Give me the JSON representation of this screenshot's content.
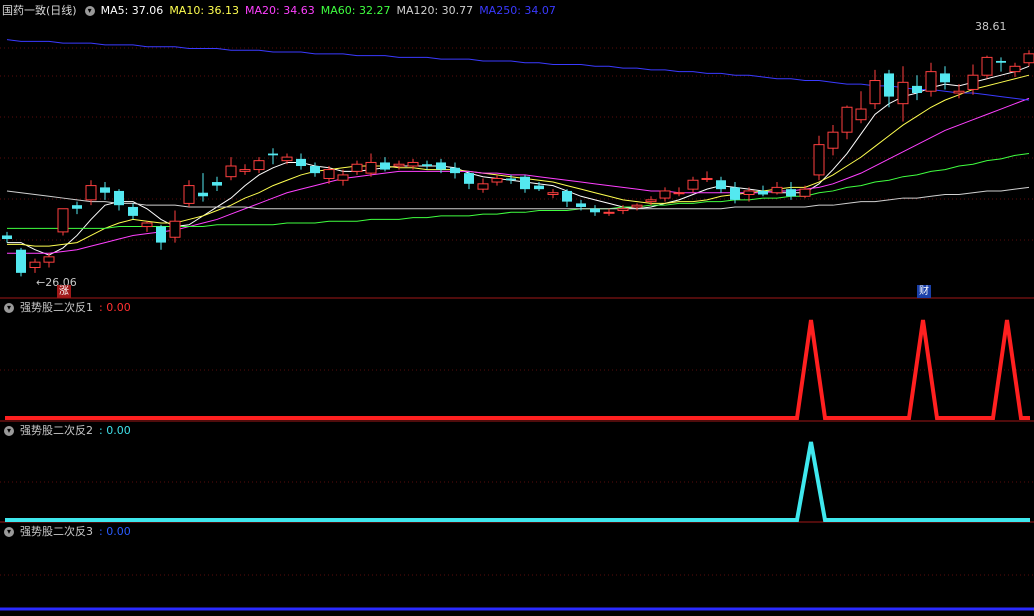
{
  "header": {
    "stock_title": "国药一致(日线)",
    "ma": [
      {
        "label": "MA5: 37.06",
        "color": "#ffffff"
      },
      {
        "label": "MA10: 36.13",
        "color": "#ffff50"
      },
      {
        "label": "MA20: 34.63",
        "color": "#ff40ff"
      },
      {
        "label": "MA60: 32.27",
        "color": "#40ff40"
      },
      {
        "label": "MA120: 30.77",
        "color": "#d0d0d0"
      },
      {
        "label": "MA250: 34.07",
        "color": "#3a3aff"
      }
    ]
  },
  "price_marks": {
    "high": "38.61",
    "low": "26.06"
  },
  "badges": {
    "zhang": "涨",
    "cai": "财"
  },
  "indicators": [
    {
      "title": "强势股二次反1",
      "value": ": 0.00",
      "color": "#ff2020"
    },
    {
      "title": "强势股二次反2",
      "value": ": 0.00",
      "color": "#3fe8ee"
    },
    {
      "title": "强势股二次反3",
      "value": ": 0.00",
      "color": "#2a5cff"
    }
  ],
  "chart_data": {
    "type": "candlestick",
    "y_range": [
      25.0,
      40.5
    ],
    "candles": [
      [
        28.4,
        28.2,
        28.6,
        28.0
      ],
      [
        27.6,
        26.3,
        27.7,
        26.1
      ],
      [
        26.6,
        26.9,
        27.1,
        26.3
      ],
      [
        26.9,
        27.2,
        27.4,
        26.6
      ],
      [
        28.6,
        29.9,
        29.9,
        28.4
      ],
      [
        30.1,
        29.9,
        30.3,
        29.6
      ],
      [
        30.4,
        31.2,
        31.5,
        30.1
      ],
      [
        31.1,
        30.8,
        31.4,
        30.4
      ],
      [
        30.9,
        30.1,
        31.0,
        29.8
      ],
      [
        30.0,
        29.5,
        30.2,
        29.3
      ],
      [
        28.9,
        29.1,
        29.2,
        28.6
      ],
      [
        28.9,
        28.0,
        29.0,
        27.6
      ],
      [
        28.3,
        29.2,
        29.8,
        28.0
      ],
      [
        30.2,
        31.2,
        31.5,
        30.0
      ],
      [
        30.8,
        30.6,
        31.9,
        30.3
      ],
      [
        31.4,
        31.2,
        31.7,
        30.9
      ],
      [
        31.7,
        32.3,
        32.8,
        31.5
      ],
      [
        32.0,
        32.1,
        32.4,
        31.8
      ],
      [
        32.1,
        32.6,
        32.8,
        31.9
      ],
      [
        33.0,
        32.9,
        33.3,
        32.4
      ],
      [
        32.6,
        32.8,
        33.0,
        32.4
      ],
      [
        32.7,
        32.3,
        33.0,
        32.1
      ],
      [
        32.3,
        31.9,
        32.5,
        31.7
      ],
      [
        31.6,
        32.1,
        32.3,
        31.3
      ],
      [
        31.5,
        31.8,
        32.1,
        31.2
      ],
      [
        32.0,
        32.4,
        32.6,
        31.8
      ],
      [
        31.9,
        32.5,
        33.0,
        31.7
      ],
      [
        32.5,
        32.1,
        32.8,
        32.0
      ],
      [
        32.3,
        32.4,
        32.6,
        32.1
      ],
      [
        32.3,
        32.5,
        32.7,
        32.1
      ],
      [
        32.4,
        32.3,
        32.6,
        32.1
      ],
      [
        32.5,
        32.1,
        32.7,
        31.9
      ],
      [
        32.2,
        31.9,
        32.5,
        31.6
      ],
      [
        31.9,
        31.3,
        32.0,
        31.0
      ],
      [
        31.0,
        31.3,
        31.6,
        30.8
      ],
      [
        31.4,
        31.6,
        31.8,
        31.2
      ],
      [
        31.6,
        31.5,
        31.8,
        31.3
      ],
      [
        31.7,
        31.0,
        31.8,
        30.8
      ],
      [
        31.2,
        31.0,
        31.4,
        30.9
      ],
      [
        30.7,
        30.8,
        31.0,
        30.5
      ],
      [
        30.9,
        30.3,
        31.0,
        30.0
      ],
      [
        30.2,
        30.0,
        30.4,
        29.8
      ],
      [
        29.9,
        29.7,
        30.1,
        29.5
      ],
      [
        29.7,
        29.7,
        29.9,
        29.5
      ],
      [
        29.8,
        29.9,
        30.1,
        29.6
      ],
      [
        30.0,
        30.1,
        30.2,
        29.8
      ],
      [
        30.3,
        30.4,
        30.6,
        30.1
      ],
      [
        30.5,
        30.9,
        31.1,
        30.3
      ],
      [
        30.8,
        30.8,
        31.1,
        30.6
      ],
      [
        31.0,
        31.5,
        31.7,
        30.8
      ],
      [
        31.6,
        31.6,
        32.0,
        31.4
      ],
      [
        31.5,
        31.0,
        31.7,
        30.8
      ],
      [
        31.1,
        30.4,
        31.4,
        30.2
      ],
      [
        30.7,
        30.9,
        31.1,
        30.3
      ],
      [
        30.9,
        30.7,
        31.2,
        30.6
      ],
      [
        30.8,
        31.1,
        31.4,
        30.7
      ],
      [
        31.0,
        30.6,
        31.4,
        30.4
      ],
      [
        30.6,
        31.0,
        31.2,
        30.5
      ],
      [
        31.8,
        33.5,
        34.0,
        31.5
      ],
      [
        33.3,
        34.2,
        34.6,
        32.9
      ],
      [
        34.2,
        35.6,
        35.7,
        33.8
      ],
      [
        34.9,
        35.5,
        36.5,
        34.7
      ],
      [
        35.8,
        37.1,
        37.7,
        35.5
      ],
      [
        37.5,
        36.2,
        37.7,
        35.6
      ],
      [
        35.8,
        37.0,
        37.9,
        34.8
      ],
      [
        36.8,
        36.4,
        37.4,
        36.0
      ],
      [
        36.5,
        37.6,
        38.1,
        36.2
      ],
      [
        37.5,
        37.0,
        37.9,
        36.6
      ],
      [
        36.4,
        36.5,
        36.9,
        36.1
      ],
      [
        36.6,
        37.4,
        38.0,
        36.3
      ],
      [
        37.4,
        38.4,
        38.5,
        37.2
      ],
      [
        38.2,
        38.1,
        38.4,
        37.6
      ],
      [
        37.6,
        37.9,
        38.1,
        37.3
      ],
      [
        38.1,
        38.6,
        38.8,
        37.9
      ]
    ],
    "ma_lines": [
      {
        "name": "MA5",
        "color": "#ffffff",
        "values": [
          28.0,
          28.0,
          27.6,
          27.3,
          27.7,
          28.4,
          29.3,
          30.1,
          30.3,
          30.3,
          29.9,
          29.3,
          28.9,
          29.0,
          29.5,
          30.0,
          30.5,
          31.2,
          31.8,
          32.2,
          32.5,
          32.5,
          32.3,
          32.2,
          32.0,
          32.0,
          32.1,
          32.2,
          32.3,
          32.3,
          32.3,
          32.3,
          32.2,
          31.9,
          31.7,
          31.6,
          31.5,
          31.4,
          31.3,
          31.2,
          30.9,
          30.6,
          30.4,
          30.2,
          30.0,
          29.9,
          30.0,
          30.2,
          30.4,
          30.7,
          31.0,
          31.2,
          31.1,
          31.0,
          30.9,
          30.8,
          30.8,
          30.8,
          31.3,
          32.1,
          33.0,
          34.1,
          35.2,
          35.8,
          36.2,
          36.4,
          36.7,
          36.9,
          36.8,
          37.0,
          37.2,
          37.4,
          37.6,
          37.9
        ]
      },
      {
        "name": "MA10",
        "color": "#ffff50",
        "values": [
          27.9,
          27.9,
          27.8,
          27.8,
          27.9,
          28.0,
          28.4,
          28.8,
          29.1,
          29.3,
          29.2,
          29.1,
          29.1,
          29.3,
          29.5,
          29.8,
          30.1,
          30.5,
          30.8,
          31.2,
          31.5,
          31.8,
          32.0,
          32.1,
          32.2,
          32.3,
          32.3,
          32.3,
          32.2,
          32.2,
          32.1,
          32.1,
          32.1,
          32.0,
          31.9,
          31.8,
          31.7,
          31.6,
          31.5,
          31.4,
          31.2,
          31.0,
          30.8,
          30.6,
          30.4,
          30.3,
          30.2,
          30.2,
          30.3,
          30.3,
          30.4,
          30.6,
          30.7,
          30.8,
          30.9,
          31.0,
          31.1,
          31.1,
          31.4,
          31.8,
          32.3,
          32.8,
          33.4,
          34.0,
          34.6,
          35.1,
          35.6,
          36.0,
          36.3,
          36.6,
          36.8,
          37.0,
          37.2,
          37.4
        ]
      },
      {
        "name": "MA20",
        "color": "#ff40ff",
        "values": [
          27.4,
          27.4,
          27.4,
          27.4,
          27.5,
          27.6,
          27.8,
          28.0,
          28.2,
          28.4,
          28.5,
          28.6,
          28.7,
          28.9,
          29.1,
          29.3,
          29.6,
          29.9,
          30.2,
          30.5,
          30.8,
          31.0,
          31.2,
          31.4,
          31.6,
          31.7,
          31.8,
          31.9,
          32.0,
          32.0,
          32.0,
          32.0,
          32.0,
          32.0,
          31.9,
          31.9,
          31.8,
          31.8,
          31.7,
          31.6,
          31.5,
          31.4,
          31.3,
          31.2,
          31.1,
          31.0,
          30.9,
          30.9,
          30.8,
          30.8,
          30.8,
          30.8,
          30.8,
          30.8,
          30.8,
          30.9,
          30.9,
          31.0,
          31.1,
          31.3,
          31.6,
          31.9,
          32.3,
          32.7,
          33.1,
          33.5,
          33.9,
          34.3,
          34.6,
          34.9,
          35.2,
          35.5,
          35.8,
          36.1
        ]
      },
      {
        "name": "MA60",
        "color": "#40ff40",
        "values": [
          28.8,
          28.8,
          28.8,
          28.8,
          28.8,
          28.8,
          28.8,
          28.8,
          28.9,
          28.9,
          28.9,
          28.9,
          28.9,
          28.9,
          28.9,
          29.0,
          29.0,
          29.0,
          29.0,
          29.0,
          29.1,
          29.1,
          29.1,
          29.2,
          29.2,
          29.2,
          29.3,
          29.3,
          29.3,
          29.4,
          29.4,
          29.5,
          29.5,
          29.5,
          29.6,
          29.6,
          29.7,
          29.7,
          29.8,
          29.8,
          29.8,
          29.9,
          29.9,
          29.9,
          30.0,
          30.0,
          30.1,
          30.1,
          30.2,
          30.2,
          30.3,
          30.3,
          30.4,
          30.4,
          30.5,
          30.5,
          30.6,
          30.6,
          30.8,
          30.9,
          31.1,
          31.2,
          31.4,
          31.5,
          31.7,
          31.8,
          32.0,
          32.1,
          32.3,
          32.4,
          32.6,
          32.7,
          32.9,
          33.0
        ]
      },
      {
        "name": "MA120",
        "color": "#d0d0d0",
        "values": [
          30.9,
          30.8,
          30.7,
          30.6,
          30.5,
          30.4,
          30.3,
          30.3,
          30.2,
          30.2,
          30.1,
          30.1,
          30.1,
          30.0,
          30.0,
          30.0,
          30.0,
          30.0,
          29.9,
          29.9,
          29.9,
          29.9,
          29.9,
          29.9,
          29.9,
          29.9,
          29.9,
          29.9,
          29.9,
          29.9,
          29.9,
          29.9,
          29.9,
          29.9,
          29.9,
          29.9,
          29.9,
          29.9,
          29.9,
          29.9,
          29.9,
          29.9,
          29.9,
          29.9,
          29.9,
          29.9,
          29.9,
          29.9,
          29.9,
          29.9,
          29.9,
          29.9,
          30.0,
          30.0,
          30.0,
          30.0,
          30.0,
          30.0,
          30.1,
          30.1,
          30.2,
          30.3,
          30.3,
          30.4,
          30.5,
          30.5,
          30.6,
          30.7,
          30.7,
          30.8,
          30.9,
          30.9,
          31.0,
          31.1
        ]
      },
      {
        "name": "MA250",
        "color": "#3a3aff",
        "values": [
          39.4,
          39.3,
          39.3,
          39.3,
          39.2,
          39.2,
          39.2,
          39.1,
          39.1,
          39.1,
          39.0,
          39.0,
          39.0,
          38.9,
          38.9,
          38.9,
          38.8,
          38.8,
          38.8,
          38.7,
          38.7,
          38.7,
          38.6,
          38.6,
          38.6,
          38.5,
          38.5,
          38.5,
          38.4,
          38.4,
          38.4,
          38.3,
          38.3,
          38.3,
          38.2,
          38.2,
          38.2,
          38.1,
          38.1,
          38.0,
          38.0,
          38.0,
          37.9,
          37.9,
          37.8,
          37.8,
          37.7,
          37.7,
          37.6,
          37.6,
          37.5,
          37.5,
          37.4,
          37.4,
          37.3,
          37.2,
          37.2,
          37.1,
          37.1,
          37.0,
          36.9,
          36.9,
          36.8,
          36.8,
          36.7,
          36.6,
          36.6,
          36.5,
          36.4,
          36.4,
          36.3,
          36.2,
          36.1,
          36.0
        ]
      }
    ],
    "signal1": {
      "color": "#ff2020",
      "spikes": [
        57,
        65,
        71
      ]
    },
    "signal2": {
      "color": "#3fe8ee",
      "spikes": [
        57
      ]
    },
    "signal3": {
      "color": "#2a5cff",
      "spikes": []
    }
  }
}
